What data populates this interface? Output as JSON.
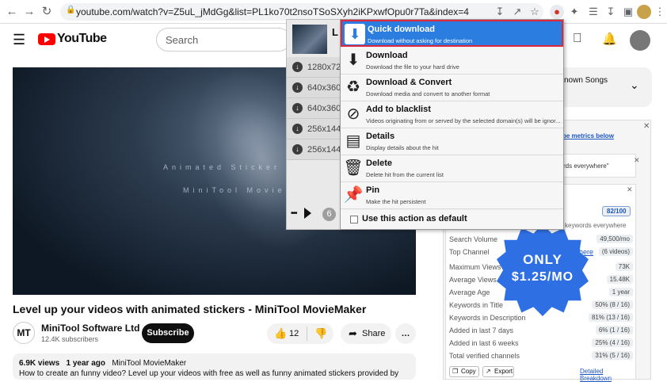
{
  "browser": {
    "url": "youtube.com/watch?v=Z5uL_jMdGg&list=PL1ko70t2nsoTSoSXyh2iKPxwfOpu0r7Ta&index=4"
  },
  "youtube": {
    "logo_text": "YouTube",
    "search_placeholder": "Search"
  },
  "video": {
    "overlay_text_1": "Animated Sticker",
    "overlay_text_2": "MiniTool MovieMaker",
    "title": "Level up your videos with animated stickers - MiniTool MovieMaker",
    "channel_avatar": "MT",
    "channel_name": "MiniTool Software Ltd",
    "subscribers": "12.4K subscribers",
    "subscribe_label": "Subscribe",
    "likes": "12",
    "share_label": "Share",
    "more_label": "…",
    "views": "6.9K views",
    "age": "1 year ago",
    "desc_channel": "MiniTool MovieMaker",
    "description": "How to create an funny video? Level up your videos with free as well as funny animated stickers provided by"
  },
  "sidebar": {
    "playlist_title": "known Songs",
    "metrics_link": "be metrics below",
    "keywords_everywhere": "rds everywhere\"",
    "score": "82/100",
    "ke_tag": "keywords everywhere",
    "rows": [
      {
        "label": "Search Volume",
        "value": "49,500/mo"
      },
      {
        "label": "Top Channel",
        "value": "(6 videos)",
        "link": "here"
      },
      {
        "label": "Maximum Views",
        "value": "73K"
      },
      {
        "label": "Average Views",
        "value": "15.48K"
      },
      {
        "label": "Average Age",
        "value": "1 year"
      },
      {
        "label": "Keywords in Title",
        "value": "50% (8 / 16)"
      },
      {
        "label": "Keywords in Description",
        "value": "81% (13 / 16)"
      },
      {
        "label": "Added in last 7 days",
        "value": "6% (1 / 16)"
      },
      {
        "label": "Added in last 6 weeks",
        "value": "25% (4 / 16)"
      },
      {
        "label": "Total verified channels",
        "value": "31% (5 / 16)"
      }
    ],
    "copy_label": "Copy",
    "export_label": "Export",
    "breakdown_label": "Detailed Breakdown",
    "badge_line1": "ONLY",
    "badge_line2": "$1.25/MO"
  },
  "downloads": {
    "header_initial": "L",
    "items": [
      "1280x72",
      "640x360",
      "640x360",
      "256x144",
      "256x144"
    ],
    "count": "6",
    "more_label": "•••"
  },
  "menu": {
    "items": [
      {
        "title": "Quick download",
        "desc": "Download without asking for destination",
        "icon": "quick-download-icon"
      },
      {
        "title": "Download",
        "desc": "Download the file to your hard drive",
        "icon": "download-icon"
      },
      {
        "title": "Download & Convert",
        "desc": "Download media and convert to another format",
        "icon": "download-convert-icon"
      },
      {
        "title": "Add to blacklist",
        "desc": "Videos originating from or served by the selected domain(s) will be ignor...",
        "icon": "blacklist-icon"
      },
      {
        "title": "Details",
        "desc": "Display details about the hit",
        "icon": "details-icon"
      },
      {
        "title": "Delete",
        "desc": "Delete hit from the current list",
        "icon": "trash-icon"
      },
      {
        "title": "Pin",
        "desc": "Make the hit persistent",
        "icon": "pin-icon"
      }
    ],
    "default_label": "Use this action as default"
  }
}
